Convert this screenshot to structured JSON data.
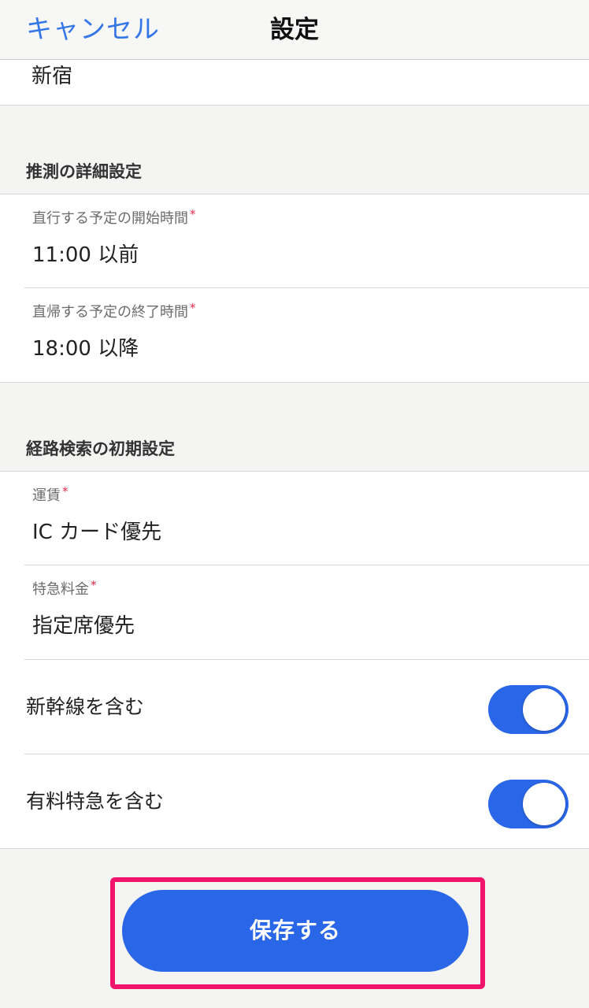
{
  "nav": {
    "cancel_label": "キャンセル",
    "title": "設定"
  },
  "station": {
    "value": "新宿"
  },
  "estimation_section": {
    "header": "推測の詳細設定",
    "start_caption": "直行する予定の開始時間",
    "start_value": "11:00 以前",
    "end_caption": "直帰する予定の終了時間",
    "end_value": "18:00 以降"
  },
  "route_section": {
    "header": "経路検索の初期設定",
    "fare_caption": "運賃",
    "fare_value": "IC カード優先",
    "express_caption": "特急料金",
    "express_value": "指定席優先",
    "shinkansen_label": "新幹線を含む",
    "shinkansen_on": true,
    "paid_express_label": "有料特急を含む",
    "paid_express_on": true
  },
  "required_mark": "*",
  "save_label": "保存する",
  "colors": {
    "accent": "#2a66e8",
    "link": "#3577e8",
    "required": "#e0294a",
    "highlight": "#f0146a",
    "background": "#f4f4f3"
  }
}
